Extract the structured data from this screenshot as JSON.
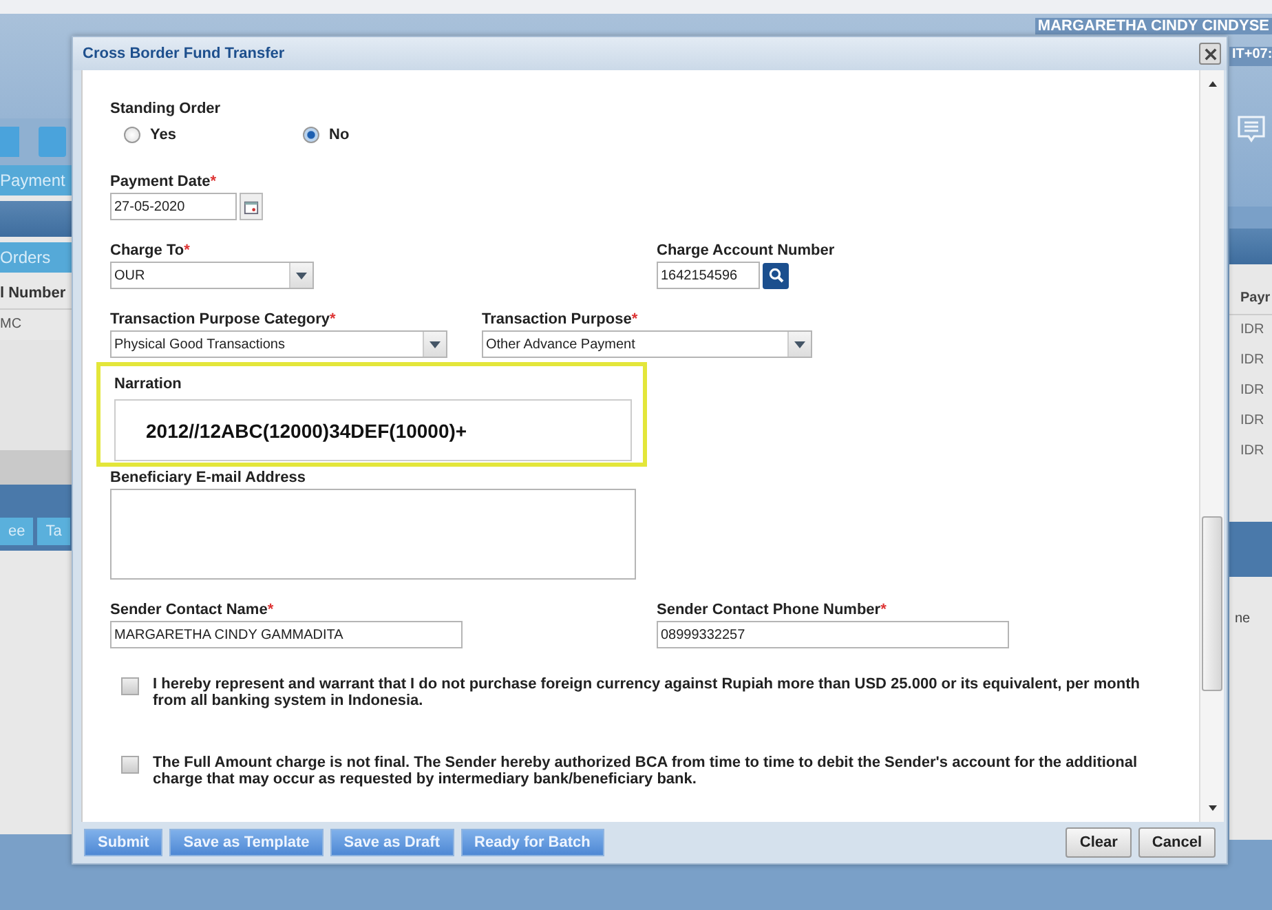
{
  "background": {
    "header_user": "MARGARETHA CINDY CINDYSE",
    "header_time": "IT+07:",
    "left_tab": "Payment",
    "left_subtab": "Orders",
    "left_column_header": "l Number",
    "left_cell": "MC",
    "left_bottom_tabs": [
      "ee",
      "Ta"
    ],
    "right_column_header": "Payr",
    "right_cells": [
      "IDR",
      "IDR",
      "IDR",
      "IDR",
      "IDR"
    ],
    "right_bottom_text": "ne"
  },
  "dialog": {
    "title": "Cross Border Fund Transfer",
    "standing_order": {
      "label": "Standing Order",
      "options": [
        {
          "label": "Yes",
          "selected": false
        },
        {
          "label": "No",
          "selected": true
        }
      ]
    },
    "payment_date": {
      "label": "Payment Date",
      "required_mark": "*",
      "value": "27-05-2020"
    },
    "charge_to": {
      "label": "Charge To",
      "required_mark": "*",
      "value": "OUR"
    },
    "charge_account": {
      "label": "Charge Account Number",
      "value": "1642154596"
    },
    "purpose_category": {
      "label": "Transaction Purpose Category",
      "required_mark": "*",
      "value": "Physical Good Transactions"
    },
    "purpose": {
      "label": "Transaction Purpose",
      "required_mark": "*",
      "value": "Other Advance Payment"
    },
    "narration": {
      "label": "Narration",
      "value": "2012//12ABC(12000)34DEF(10000)+",
      "highlighted": true
    },
    "beneficiary_email": {
      "label": "Beneficiary E-mail Address"
    },
    "sender_name": {
      "label": "Sender Contact Name",
      "required_mark": "*",
      "value": "MARGARETHA CINDY GAMMADITA"
    },
    "sender_phone": {
      "label": "Sender Contact Phone Number",
      "required_mark": "*",
      "value": "08999332257"
    },
    "declarations": [
      {
        "text": "I hereby represent and warrant that I do not purchase foreign currency against Rupiah more than USD 25.000 or its equivalent, per month from all banking system in Indonesia.",
        "checked": false
      },
      {
        "text": "The Full Amount charge is not final. The Sender hereby authorized BCA from time to time to debit the Sender's account for the additional charge that may occur as requested by intermediary bank/beneficiary bank.",
        "checked": false
      }
    ],
    "left_buttons": [
      "Submit",
      "Save as Template",
      "Save as Draft",
      "Ready for Batch"
    ],
    "right_buttons": [
      "Clear",
      "Cancel"
    ]
  }
}
